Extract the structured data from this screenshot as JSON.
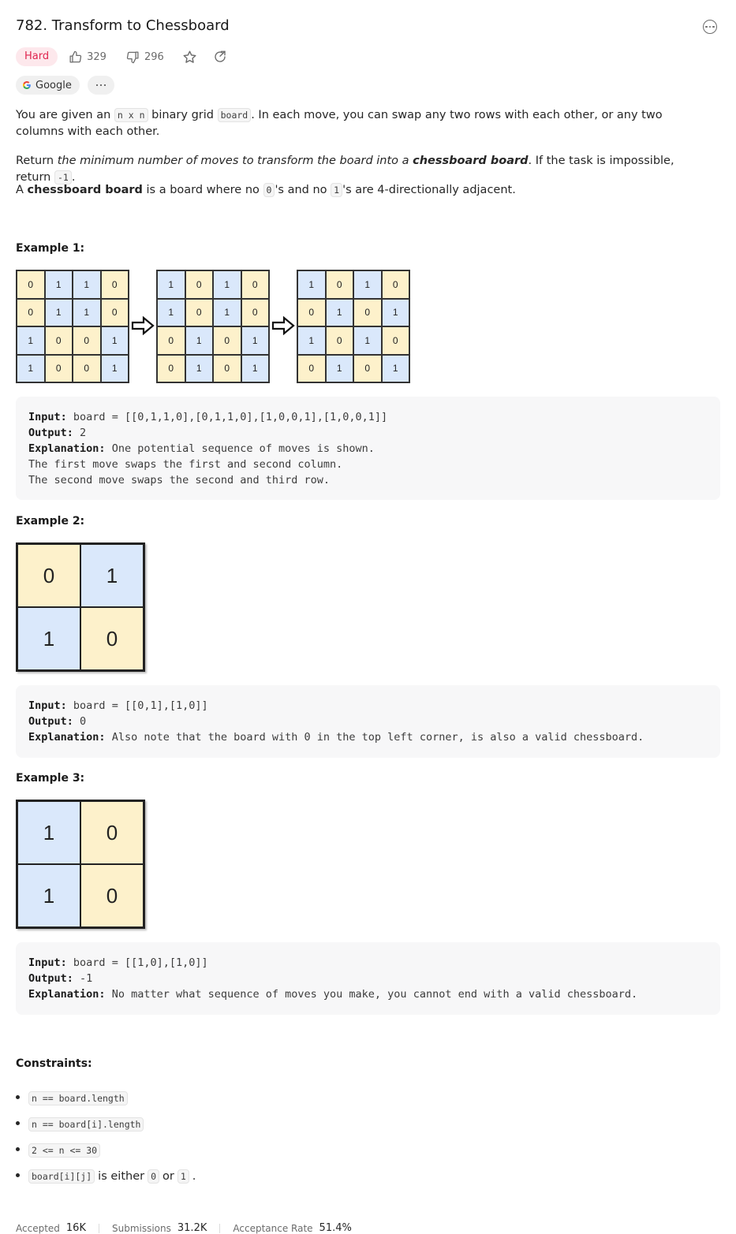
{
  "problem": {
    "title": "782. Transform to Chessboard",
    "difficulty": "Hard",
    "likes": "329",
    "dislikes": "296",
    "company_tag": "Google"
  },
  "description": {
    "p1_a": "You are given an ",
    "p1_code1": "n x n",
    "p1_b": " binary grid ",
    "p1_code2": "board",
    "p1_c": ". In each move, you can swap any two rows with each other, or any two columns with each other.",
    "p2_a": "Return ",
    "p2_em": "the minimum number of moves to transform the board into a ",
    "p2_em_bold": "chessboard board",
    "p2_b": ". If the task is impossible, return ",
    "p2_code": "-1",
    "p2_c": ".",
    "p3_a": "A ",
    "p3_bold": "chessboard board",
    "p3_b": " is a board where no ",
    "p3_code1": "0",
    "p3_c": "'s and no ",
    "p3_code2": "1",
    "p3_d": "'s are 4-directionally adjacent."
  },
  "examples": [
    {
      "heading": "Example 1:",
      "boards": [
        [
          [
            0,
            1,
            1,
            0
          ],
          [
            0,
            1,
            1,
            0
          ],
          [
            1,
            0,
            0,
            1
          ],
          [
            1,
            0,
            0,
            1
          ]
        ],
        [
          [
            1,
            0,
            1,
            0
          ],
          [
            1,
            0,
            1,
            0
          ],
          [
            0,
            1,
            0,
            1
          ],
          [
            0,
            1,
            0,
            1
          ]
        ],
        [
          [
            1,
            0,
            1,
            0
          ],
          [
            0,
            1,
            0,
            1
          ],
          [
            1,
            0,
            1,
            0
          ],
          [
            0,
            1,
            0,
            1
          ]
        ]
      ],
      "input_label": "Input:",
      "input": "board = [[0,1,1,0],[0,1,1,0],[1,0,0,1],[1,0,0,1]]",
      "output_label": "Output:",
      "output": "2",
      "explanation_label": "Explanation:",
      "explanation": "One potential sequence of moves is shown.\nThe first move swaps the first and second column.\nThe second move swaps the second and third row."
    },
    {
      "heading": "Example 2:",
      "boards": [
        [
          [
            0,
            1
          ],
          [
            1,
            0
          ]
        ]
      ],
      "input_label": "Input:",
      "input": "board = [[0,1],[1,0]]",
      "output_label": "Output:",
      "output": "0",
      "explanation_label": "Explanation:",
      "explanation": "Also note that the board with 0 in the top left corner, is also a valid chessboard."
    },
    {
      "heading": "Example 3:",
      "boards": [
        [
          [
            1,
            0
          ],
          [
            1,
            0
          ]
        ]
      ],
      "input_label": "Input:",
      "input": "board = [[1,0],[1,0]]",
      "output_label": "Output:",
      "output": "-1",
      "explanation_label": "Explanation:",
      "explanation": "No matter what sequence of moves you make, you cannot end with a valid chessboard."
    }
  ],
  "constraints": {
    "heading": "Constraints:",
    "items": [
      {
        "code": "n == board.length",
        "text": ""
      },
      {
        "code": "n == board[i].length",
        "text": ""
      },
      {
        "code": "2 <= n <= 30",
        "text": ""
      },
      {
        "code": "board[i][j]",
        "text_a": " is either ",
        "code2": "0",
        "text_b": " or ",
        "code3": "1",
        "text_c": "."
      }
    ]
  },
  "stats": {
    "accepted_label": "Accepted",
    "accepted": "16K",
    "submissions_label": "Submissions",
    "submissions": "31.2K",
    "rate_label": "Acceptance Rate",
    "rate": "51.4%"
  },
  "colors": {
    "zero_cell": "#fdf1cb",
    "one_cell": "#dae8fb",
    "hard_badge_bg": "#fde8ec",
    "hard_badge_text": "#e0254f"
  }
}
